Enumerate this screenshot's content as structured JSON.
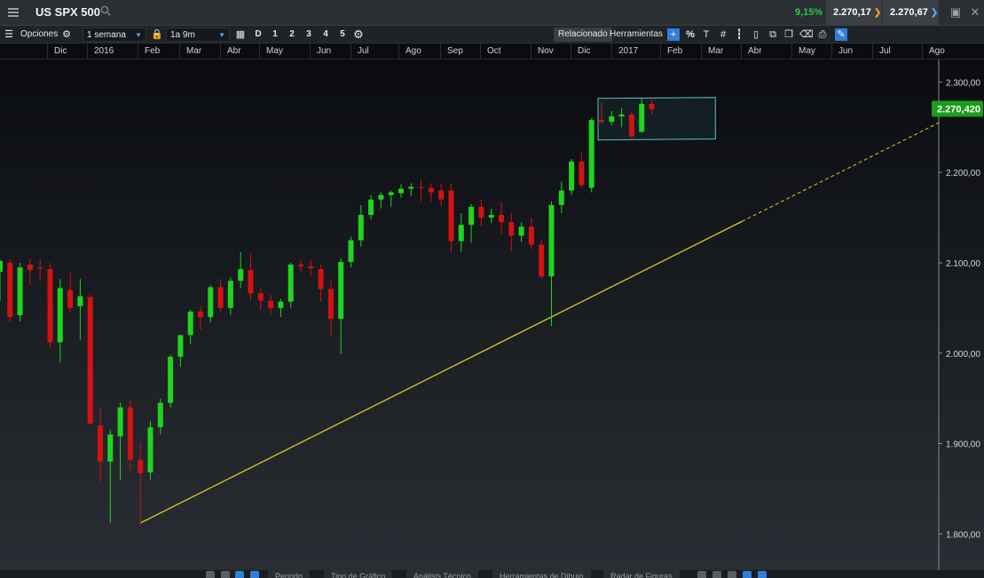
{
  "header": {
    "symbol": "US SPX 500",
    "change": "9,15%",
    "sell_price": "2.270,17",
    "buy_price": "2.270,67"
  },
  "toolbar": {
    "options_label": "Opciones",
    "interval": "1 semana",
    "range": "1a 9m",
    "period_buttons": [
      "D",
      "1",
      "2",
      "3",
      "4",
      "5"
    ],
    "related_label": "Relacionado",
    "tools_label": "Herramientas"
  },
  "bottombar": {
    "buttons": [
      "Periodo",
      "Tipo de Gráfico",
      "Análisis Técnico",
      "Herramientas de Dibujo",
      "Radar de Figuras"
    ]
  },
  "colors": {
    "up": "#1fd41f",
    "down": "#d41212",
    "trendline": "#e0d21a",
    "price_badge": "#1a9d1a"
  },
  "chart_data": {
    "type": "candlestick",
    "title": "US SPX 500",
    "x_labels": [
      "Dic",
      "2016",
      "Feb",
      "Mar",
      "Abr",
      "May",
      "Jun",
      "Jul",
      "Ago",
      "Sep",
      "Oct",
      "Nov",
      "Dic",
      "2017",
      "Feb",
      "Mar",
      "Abr",
      "May",
      "Jun",
      "Jul",
      "Ago"
    ],
    "y_ticks": [
      "2.300,00",
      "2.200,00",
      "2.100,00",
      "2.000,00",
      "1.900,00",
      "1.800,00"
    ],
    "ylim": [
      1760,
      2325
    ],
    "last_price_label": "2.270,420",
    "last_price": 2270.42,
    "grid": false,
    "candles": [
      {
        "o": 2090,
        "h": 2104,
        "l": 2058,
        "c": 2102
      },
      {
        "o": 2100,
        "h": 2104,
        "l": 2035,
        "c": 2040
      },
      {
        "o": 2042,
        "h": 2100,
        "l": 2035,
        "c": 2095
      },
      {
        "o": 2098,
        "h": 2105,
        "l": 2075,
        "c": 2092
      },
      {
        "o": 2095,
        "h": 2104,
        "l": 2080,
        "c": 2094
      },
      {
        "o": 2093,
        "h": 2100,
        "l": 2005,
        "c": 2012
      },
      {
        "o": 2012,
        "h": 2082,
        "l": 1990,
        "c": 2072
      },
      {
        "o": 2070,
        "h": 2090,
        "l": 2045,
        "c": 2050
      },
      {
        "o": 2052,
        "h": 2082,
        "l": 2015,
        "c": 2063
      },
      {
        "o": 2062,
        "h": 2065,
        "l": 1920,
        "c": 1922
      },
      {
        "o": 1920,
        "h": 1940,
        "l": 1858,
        "c": 1880
      },
      {
        "o": 1880,
        "h": 1915,
        "l": 1812,
        "c": 1910
      },
      {
        "o": 1908,
        "h": 1945,
        "l": 1860,
        "c": 1940
      },
      {
        "o": 1940,
        "h": 1948,
        "l": 1870,
        "c": 1882
      },
      {
        "o": 1882,
        "h": 1900,
        "l": 1810,
        "c": 1867
      },
      {
        "o": 1868,
        "h": 1925,
        "l": 1860,
        "c": 1918
      },
      {
        "o": 1918,
        "h": 1950,
        "l": 1910,
        "c": 1945
      },
      {
        "o": 1945,
        "h": 1998,
        "l": 1940,
        "c": 1996
      },
      {
        "o": 1996,
        "h": 2020,
        "l": 1985,
        "c": 2020
      },
      {
        "o": 2020,
        "h": 2048,
        "l": 2010,
        "c": 2046
      },
      {
        "o": 2046,
        "h": 2052,
        "l": 2025,
        "c": 2040
      },
      {
        "o": 2040,
        "h": 2075,
        "l": 2034,
        "c": 2073
      },
      {
        "o": 2073,
        "h": 2082,
        "l": 2046,
        "c": 2050
      },
      {
        "o": 2050,
        "h": 2084,
        "l": 2042,
        "c": 2080
      },
      {
        "o": 2080,
        "h": 2112,
        "l": 2072,
        "c": 2093
      },
      {
        "o": 2092,
        "h": 2110,
        "l": 2058,
        "c": 2066
      },
      {
        "o": 2066,
        "h": 2072,
        "l": 2048,
        "c": 2058
      },
      {
        "o": 2058,
        "h": 2065,
        "l": 2042,
        "c": 2050
      },
      {
        "o": 2050,
        "h": 2060,
        "l": 2040,
        "c": 2057
      },
      {
        "o": 2057,
        "h": 2100,
        "l": 2050,
        "c": 2098
      },
      {
        "o": 2098,
        "h": 2104,
        "l": 2090,
        "c": 2096
      },
      {
        "o": 2096,
        "h": 2104,
        "l": 2085,
        "c": 2094
      },
      {
        "o": 2093,
        "h": 2098,
        "l": 2057,
        "c": 2071
      },
      {
        "o": 2071,
        "h": 2080,
        "l": 2018,
        "c": 2038
      },
      {
        "o": 2038,
        "h": 2105,
        "l": 1999,
        "c": 2101
      },
      {
        "o": 2101,
        "h": 2129,
        "l": 2095,
        "c": 2125
      },
      {
        "o": 2125,
        "h": 2164,
        "l": 2118,
        "c": 2153
      },
      {
        "o": 2153,
        "h": 2175,
        "l": 2148,
        "c": 2170
      },
      {
        "o": 2170,
        "h": 2178,
        "l": 2160,
        "c": 2175
      },
      {
        "o": 2175,
        "h": 2180,
        "l": 2162,
        "c": 2178
      },
      {
        "o": 2177,
        "h": 2187,
        "l": 2172,
        "c": 2182
      },
      {
        "o": 2182,
        "h": 2188,
        "l": 2174,
        "c": 2184
      },
      {
        "o": 2184,
        "h": 2193,
        "l": 2168,
        "c": 2183
      },
      {
        "o": 2183,
        "h": 2188,
        "l": 2168,
        "c": 2178
      },
      {
        "o": 2180,
        "h": 2187,
        "l": 2162,
        "c": 2170
      },
      {
        "o": 2180,
        "h": 2188,
        "l": 2112,
        "c": 2124
      },
      {
        "o": 2124,
        "h": 2155,
        "l": 2112,
        "c": 2142
      },
      {
        "o": 2142,
        "h": 2165,
        "l": 2122,
        "c": 2162
      },
      {
        "o": 2162,
        "h": 2170,
        "l": 2140,
        "c": 2150
      },
      {
        "o": 2150,
        "h": 2160,
        "l": 2144,
        "c": 2153
      },
      {
        "o": 2153,
        "h": 2168,
        "l": 2132,
        "c": 2145
      },
      {
        "o": 2145,
        "h": 2155,
        "l": 2113,
        "c": 2130
      },
      {
        "o": 2130,
        "h": 2145,
        "l": 2123,
        "c": 2140
      },
      {
        "o": 2140,
        "h": 2150,
        "l": 2115,
        "c": 2120
      },
      {
        "o": 2120,
        "h": 2125,
        "l": 2083,
        "c": 2085
      },
      {
        "o": 2085,
        "h": 2168,
        "l": 2030,
        "c": 2164
      },
      {
        "o": 2164,
        "h": 2190,
        "l": 2155,
        "c": 2180
      },
      {
        "o": 2180,
        "h": 2215,
        "l": 2175,
        "c": 2212
      },
      {
        "o": 2212,
        "h": 2222,
        "l": 2183,
        "c": 2186
      },
      {
        "o": 2183,
        "h": 2260,
        "l": 2178,
        "c": 2258
      },
      {
        "o": 2258,
        "h": 2278,
        "l": 2254,
        "c": 2256
      },
      {
        "o": 2256,
        "h": 2268,
        "l": 2252,
        "c": 2262
      },
      {
        "o": 2262,
        "h": 2271,
        "l": 2250,
        "c": 2264
      },
      {
        "o": 2264,
        "h": 2267,
        "l": 2238,
        "c": 2240
      },
      {
        "o": 2245,
        "h": 2282,
        "l": 2244,
        "c": 2276
      },
      {
        "o": 2276,
        "h": 2281,
        "l": 2264,
        "c": 2270
      }
    ],
    "trendline": {
      "from": {
        "index": 14,
        "price": 1812
      },
      "solid_to_index": 74,
      "dashed_to_price": 2255
    },
    "channel": {
      "start_index": 60,
      "end_index": 71,
      "top": [
        2282,
        2283
      ],
      "bottom": [
        2236,
        2237
      ]
    }
  }
}
